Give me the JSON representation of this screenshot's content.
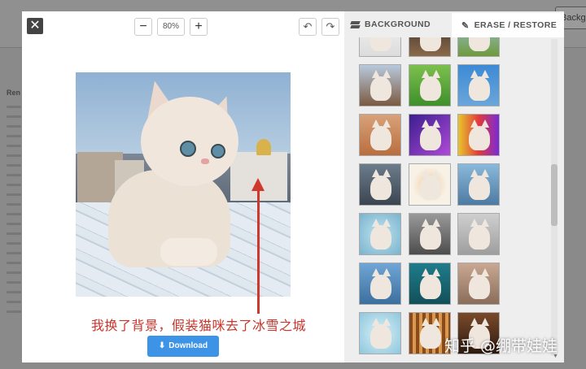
{
  "background_page": {
    "top_button_label": "Backgro",
    "side_label": "Ren"
  },
  "modal": {
    "close_icon": "close-icon",
    "zoom": {
      "minus_label": "−",
      "value": "80%",
      "plus_label": "+"
    },
    "history": {
      "undo_icon": "undo-icon",
      "redo_icon": "redo-icon"
    },
    "annotation_text": "我换了背景，假装猫咪去了冰雪之城",
    "download_label": "Download",
    "download_icon": "download-icon"
  },
  "panel": {
    "tabs": [
      {
        "label": "BACKGROUND",
        "icon": "layers-icon",
        "active": false
      },
      {
        "label": "ERASE / RESTORE",
        "icon": "eraser-icon",
        "active": true
      }
    ],
    "thumbnails": [
      {
        "bg": "linear-gradient(#f4f4f4,#dcdcdc)"
      },
      {
        "bg": "linear-gradient(#3b2c2a,#8a6a4a)"
      },
      {
        "bg": "linear-gradient(#9fc7e6,#6e9a3c)"
      },
      {
        "bg": "linear-gradient(#b8c9dc,#7b5a42)"
      },
      {
        "bg": "linear-gradient(#7cc14e,#3f8f2a)"
      },
      {
        "bg": "linear-gradient(#3d8ad6,#6aa6d9)"
      },
      {
        "bg": "linear-gradient(#d8a27a,#b96e3e)"
      },
      {
        "bg": "linear-gradient(135deg,#3a1e8e,#b04ad8)"
      },
      {
        "bg": "linear-gradient(90deg,#e6c62c,#e23a3a,#7a2ad8)"
      },
      {
        "bg": "linear-gradient(#6d7c8b,#3a4550)"
      },
      {
        "bg": "radial-gradient(circle,#f3d9b5 20%,#f7f1e6 60%)"
      },
      {
        "bg": "linear-gradient(#8bb9db,#4c7aa2)"
      },
      {
        "bg": "radial-gradient(circle,#bfe4f2,#7ab3cc)"
      },
      {
        "bg": "linear-gradient(#9a9a9a,#4d4d4d)"
      },
      {
        "bg": "linear-gradient(#cfcfcf,#9e9e9e)"
      },
      {
        "bg": "linear-gradient(#6fa6d6,#3c6f9e)"
      },
      {
        "bg": "linear-gradient(#1f7c8c,#12505a)"
      },
      {
        "bg": "linear-gradient(#c8a892,#8a6d5a)"
      },
      {
        "bg": "radial-gradient(circle,#d9f0f8,#8ec7dd)"
      },
      {
        "bg": "repeating-linear-gradient(90deg,#8a4a1e 0 4px,#d89a4a 4px 8px)"
      },
      {
        "bg": "linear-gradient(#7a4a2a,#2e1a10)"
      }
    ]
  },
  "watermark": "知乎 @绷带娃娃",
  "colors": {
    "accent": "#3d94e6",
    "annotation": "#c9342b"
  }
}
